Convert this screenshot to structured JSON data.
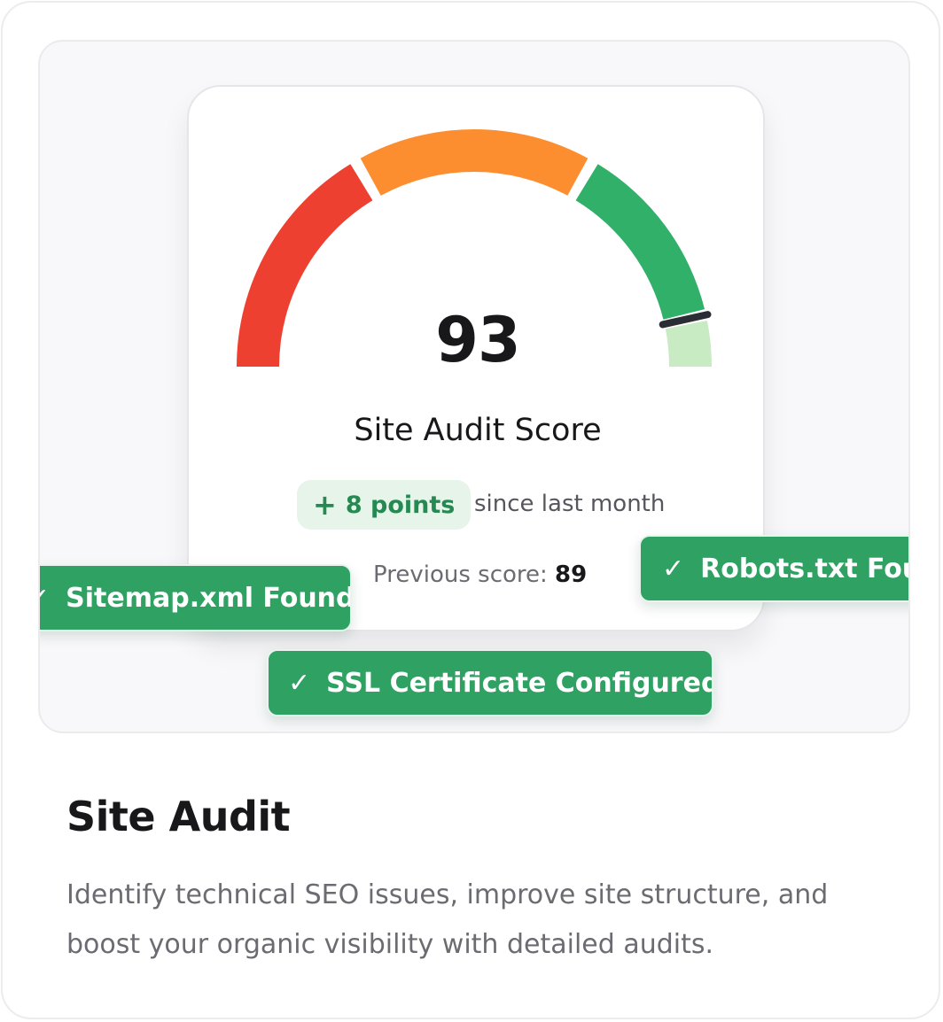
{
  "score_card": {
    "score": "93",
    "title": "Site Audit Score",
    "delta": {
      "icon": "plus-icon",
      "value": "8 points"
    },
    "since": "since last month",
    "previous_label": "Previous score:",
    "previous_value": "89",
    "gauge": {
      "score_fraction": 0.93,
      "segments": [
        {
          "name": "poor",
          "color": "#ee4030"
        },
        {
          "name": "fair",
          "color": "#fd8e2f"
        },
        {
          "name": "good",
          "color": "#31b06a"
        },
        {
          "name": "remaining",
          "color": "#c9ebc4"
        }
      ],
      "marker_color": "#2a2d33"
    }
  },
  "checks": [
    {
      "label": "Sitemap.xml Found",
      "icon": "check-icon"
    },
    {
      "label": "Robots.txt Found",
      "icon": "check-icon"
    },
    {
      "label": "SSL Certificate Configured",
      "icon": "check-icon"
    }
  ],
  "feature": {
    "title": "Site Audit",
    "description": "Identify technical SEO issues, improve site structure, and boost your organic visibility with detailed audits."
  },
  "colors": {
    "accent_green": "#2fa163",
    "badge_bg": "#e6f4ea",
    "badge_text": "#248a52"
  }
}
